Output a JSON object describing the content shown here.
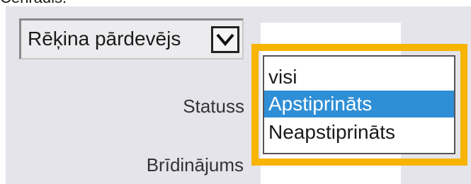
{
  "top_fragment": "Cenrādis:",
  "filter": {
    "select_label": "Rēķina pārdevējs"
  },
  "labels": {
    "status": "Statuss",
    "warning": "Brīdinājums"
  },
  "dropdown": {
    "options": [
      "visi",
      "Apstiprināts",
      "Neapstiprināts"
    ],
    "selected": "Apstiprināts"
  },
  "colors": {
    "highlight": "#f7b400",
    "selection": "#2f8fd6",
    "panel": "#e4e4ea"
  },
  "icons": {
    "select_arrow": "chevron-down-icon"
  }
}
